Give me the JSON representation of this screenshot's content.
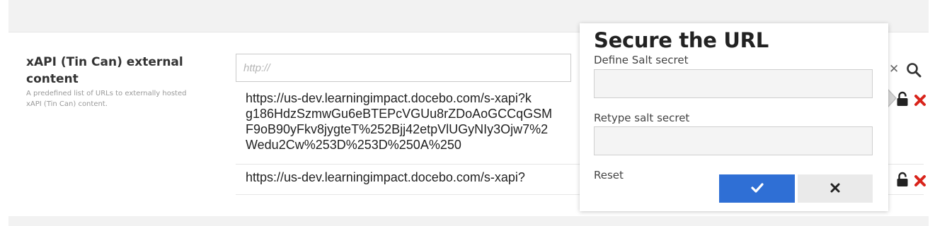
{
  "field": {
    "title": "xAPI (Tin Can) external content",
    "description": "A predefined list of URLs to externally hosted xAPI (Tin Can) content."
  },
  "url_input": {
    "placeholder": "http://",
    "value": ""
  },
  "url_list": [
    {
      "lines": [
        "https://us-dev.learningimpact.docebo.com/s-xapi?k",
        "g186HdzSzmwGu6eBTEPcVGUu8rZDoAoGCCqGSM",
        "F9oB90yFkv8jygteT%252Bjj42etpVlUGyNIy3Ojw7%2",
        "Wedu2Cw%253D%253D%250A%250"
      ]
    },
    {
      "lines": [
        "https://us-dev.learningimpact.docebo.com/s-xapi?"
      ]
    }
  ],
  "popup": {
    "title": "Secure the URL",
    "salt_label": "Define Salt secret",
    "salt_value": "",
    "retype_label": "Retype salt secret",
    "retype_value": "",
    "reset_label": "Reset"
  },
  "colors": {
    "confirm": "#2f6fd5",
    "cancel": "#eaeaea",
    "delete": "#d9241b",
    "band": "#f2f2f2"
  },
  "icons": {
    "clear": "close-icon",
    "search": "search-icon",
    "lock": "lock-open-icon",
    "delete": "delete-icon",
    "confirm": "check-icon",
    "cancel": "close-icon"
  }
}
